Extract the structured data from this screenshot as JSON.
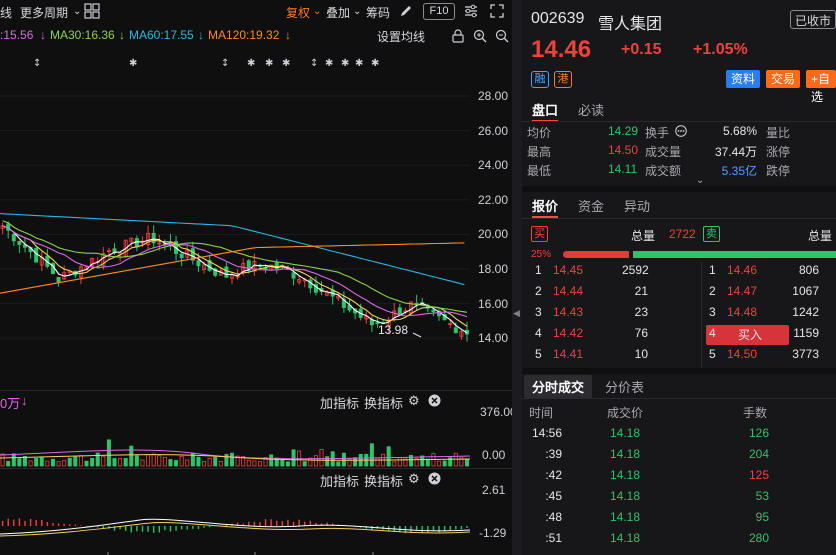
{
  "toolbar": {
    "left_label": "线",
    "period_label": "更多周期",
    "restore_label": "复权",
    "overlay_label": "叠加",
    "chips_label": "筹码",
    "f10_label": "F10"
  },
  "ma_legend": {
    "ma_short": ":15.56",
    "ma30": "MA30:16.36",
    "ma60": "MA60:17.55",
    "ma120": "MA120:19.32",
    "settings": "设置均线"
  },
  "price_axis": [
    "28.00",
    "26.00",
    "24.00",
    "22.00",
    "20.00",
    "18.00",
    "16.00",
    "14.00"
  ],
  "low_marker": "13.98",
  "volume_panel": {
    "unit_label": "0万",
    "add_indicator": "加指标",
    "switch_indicator": "换指标",
    "max": "376.00",
    "min": "0.00"
  },
  "macd_panel": {
    "add_indicator": "加指标",
    "switch_indicator": "换指标",
    "max": "2.61",
    "min": "-1.29"
  },
  "stock": {
    "code": "002639",
    "name": "雪人集团",
    "status": "已收市",
    "price": "14.46",
    "change": "+0.15",
    "change_pct": "+1.05%",
    "tag_margin": "融",
    "tag_hk": "港",
    "btn_info": "资料",
    "btn_trade": "交易",
    "btn_watch": "+自选"
  },
  "tabs1": {
    "active": "盘口",
    "other": "必读"
  },
  "stats": [
    {
      "label": "均价",
      "value": "14.29",
      "label2": "换手",
      "value2": "5.68%",
      "label3": "量比"
    },
    {
      "label": "最高",
      "value": "14.50",
      "label2": "成交量",
      "value2": "37.44万",
      "label3": "涨停"
    },
    {
      "label": "最低",
      "value": "14.11",
      "label2": "成交额",
      "value2": "5.35亿",
      "label3": "跌停"
    }
  ],
  "tabs2": {
    "active": "报价",
    "funds": "资金",
    "anomaly": "异动"
  },
  "order_book": {
    "buy_tag": "买",
    "sell_tag": "卖",
    "total_label": "总量",
    "buy_total": "2722",
    "sell_total_label": "总量",
    "ratio": "25%",
    "buy_ratio": 0.25,
    "bids": [
      {
        "level": "1",
        "price": "14.45",
        "qty": "2592"
      },
      {
        "level": "2",
        "price": "14.44",
        "qty": "21"
      },
      {
        "level": "3",
        "price": "14.43",
        "qty": "23"
      },
      {
        "level": "4",
        "price": "14.42",
        "qty": "76"
      },
      {
        "level": "5",
        "price": "14.41",
        "qty": "10"
      }
    ],
    "asks": [
      {
        "level": "1",
        "price": "14.46",
        "qty": "806"
      },
      {
        "level": "2",
        "price": "14.47",
        "qty": "1067"
      },
      {
        "level": "3",
        "price": "14.48",
        "qty": "1242"
      },
      {
        "level": "4",
        "price": "买入",
        "qty": "1159"
      },
      {
        "level": "5",
        "price": "14.50",
        "qty": "3773"
      }
    ]
  },
  "tabs3": {
    "active": "分时成交",
    "other": "分价表"
  },
  "trades_header": {
    "time": "时间",
    "price": "成交价",
    "qty": "手数"
  },
  "trades": [
    {
      "time": "14:56",
      "price": "14.18",
      "qty": "126",
      "dir": "buy"
    },
    {
      "time": ":39",
      "price": "14.18",
      "qty": "204",
      "dir": "buy"
    },
    {
      "time": ":42",
      "price": "14.18",
      "qty": "125",
      "dir": "sell"
    },
    {
      "time": ":45",
      "price": "14.18",
      "qty": "53",
      "dir": "buy"
    },
    {
      "time": ":48",
      "price": "14.18",
      "qty": "95",
      "dir": "buy"
    },
    {
      "time": ":51",
      "price": "14.18",
      "qty": "280",
      "dir": "buy"
    }
  ],
  "colors": {
    "up": "#f0413d",
    "down": "#2ec46a",
    "accent": "#ff7a1a",
    "ma5": "#ffffff",
    "ma10": "#f5d25a",
    "ma20": "#d96ae6",
    "ma30": "#8bd14b",
    "ma60": "#2ab8e0",
    "ma120": "#ff8a1f"
  }
}
